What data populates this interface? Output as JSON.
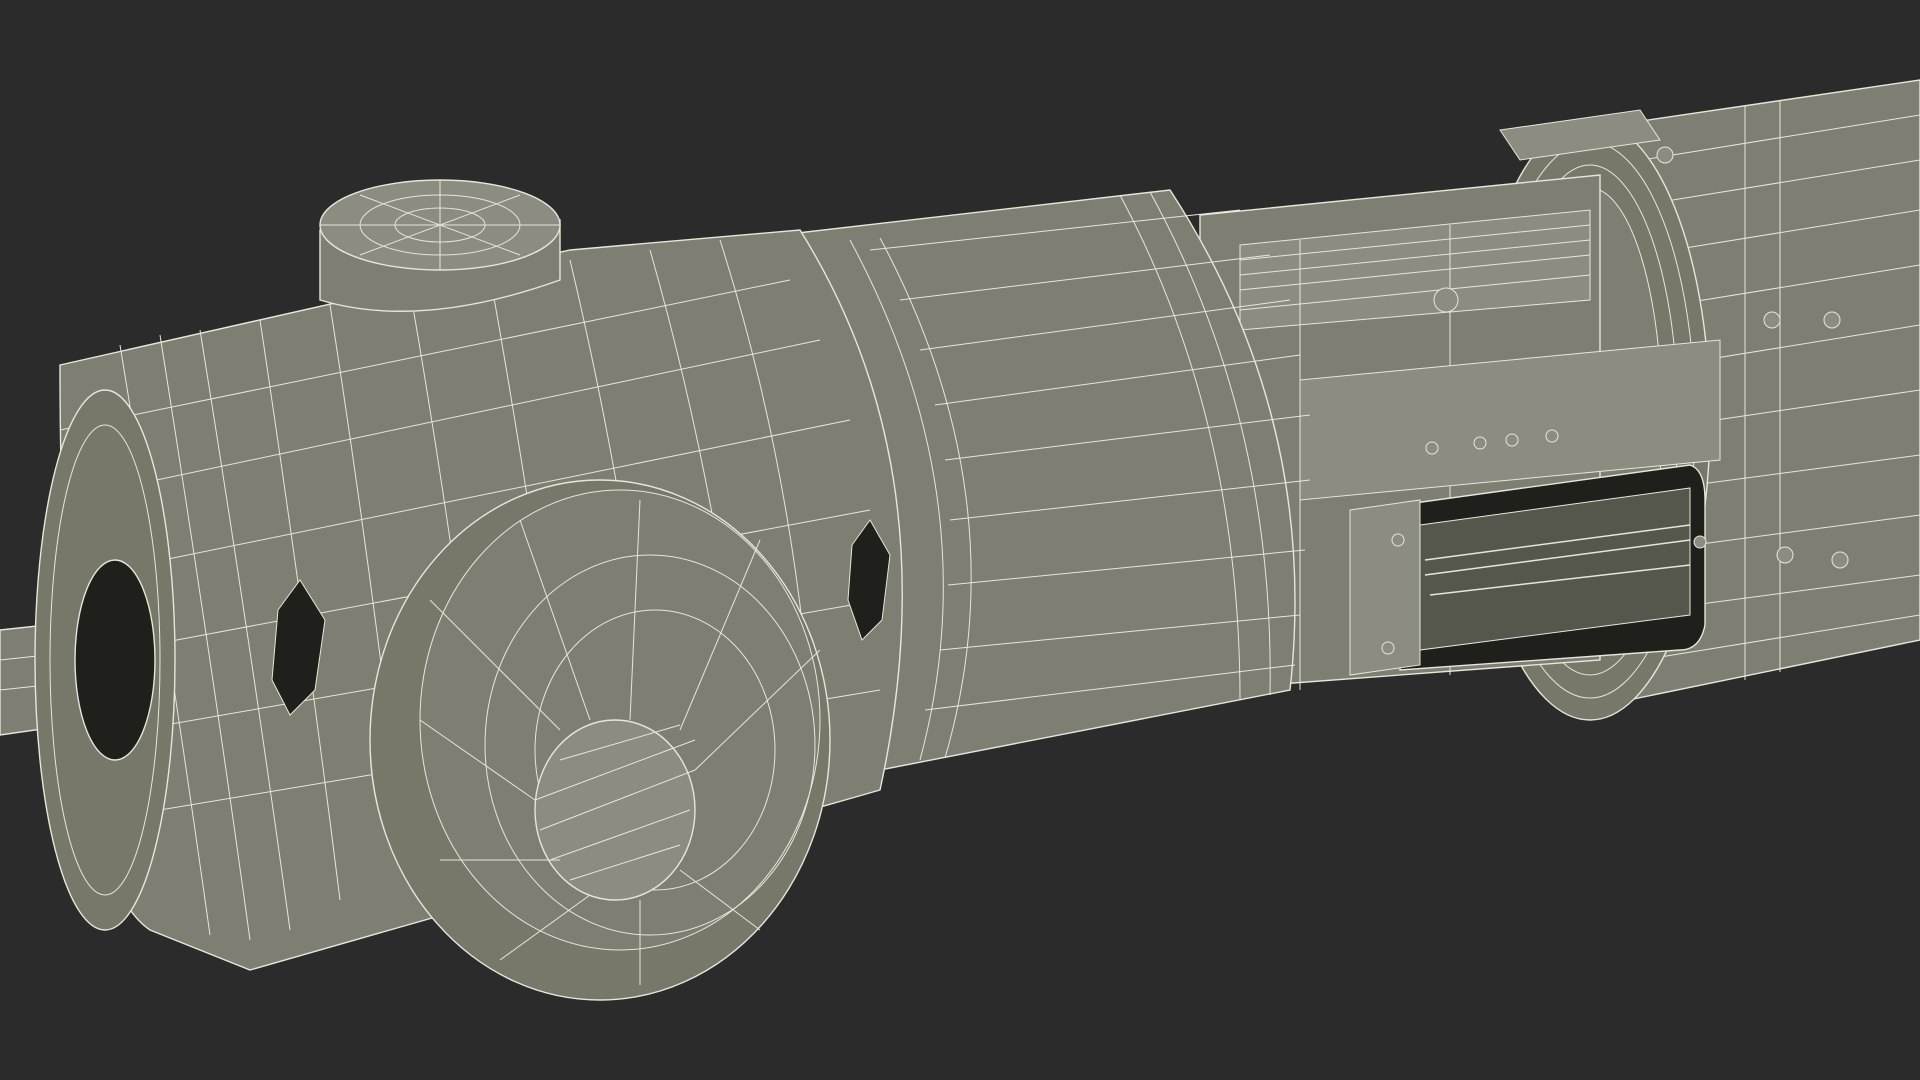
{
  "scene": {
    "subject": "wireframe-3d-model",
    "colors": {
      "background": "#2b2b2b",
      "surface": "#7e7f72",
      "surface_light": "#8c8d80",
      "surface_dark": "#66675c",
      "cavity": "#1f1f1c",
      "wire": "#e6e6da"
    }
  }
}
